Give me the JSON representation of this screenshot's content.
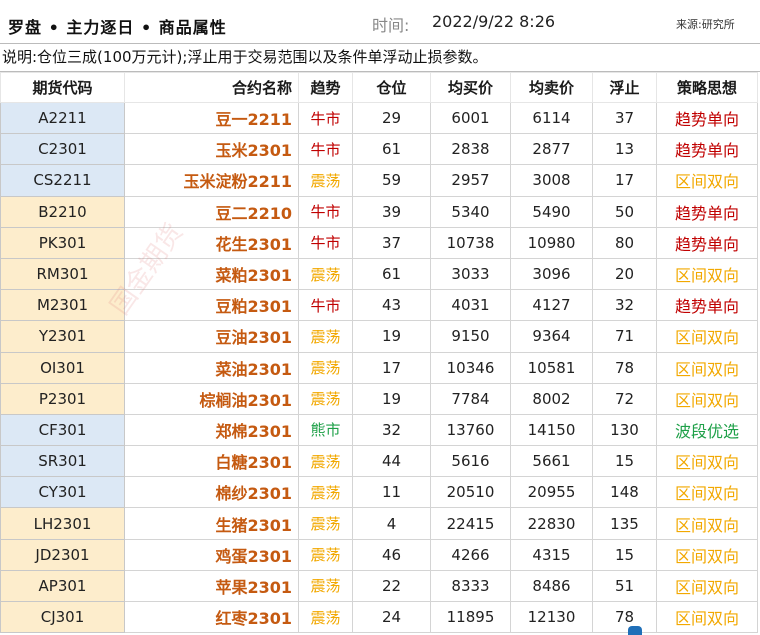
{
  "header": {
    "title": "罗盘 • 主力逐日 • 商品属性",
    "time_label": "时间:",
    "time_value": "2022/9/22 8:26",
    "source": "来源:研究所"
  },
  "note": "说明:仓位三成(100万元计);浮止用于交易范围以及条件单浮动止损参数。",
  "columns": [
    "期货代码",
    "合约名称",
    "趋势",
    "仓位",
    "均买价",
    "均卖价",
    "浮止",
    "策略思想"
  ],
  "rows": [
    {
      "code": "A2211",
      "name": "豆一2211",
      "trend": "牛市",
      "pos": "29",
      "buy": "6001",
      "sell": "6114",
      "stop": "37",
      "strategy": "趋势单向",
      "group": "blue",
      "trend_color": "red",
      "strat_color": "red"
    },
    {
      "code": "C2301",
      "name": "玉米2301",
      "trend": "牛市",
      "pos": "61",
      "buy": "2838",
      "sell": "2877",
      "stop": "13",
      "strategy": "趋势单向",
      "group": "blue",
      "trend_color": "red",
      "strat_color": "red"
    },
    {
      "code": "CS2211",
      "name": "玉米淀粉2211",
      "trend": "震荡",
      "pos": "59",
      "buy": "2957",
      "sell": "3008",
      "stop": "17",
      "strategy": "区间双向",
      "group": "blue",
      "trend_color": "yellow",
      "strat_color": "yellow"
    },
    {
      "code": "B2210",
      "name": "豆二2210",
      "trend": "牛市",
      "pos": "39",
      "buy": "5340",
      "sell": "5490",
      "stop": "50",
      "strategy": "趋势单向",
      "group": "yellow",
      "trend_color": "red",
      "strat_color": "red"
    },
    {
      "code": "PK301",
      "name": "花生2301",
      "trend": "牛市",
      "pos": "37",
      "buy": "10738",
      "sell": "10980",
      "stop": "80",
      "strategy": "趋势单向",
      "group": "yellow",
      "trend_color": "red",
      "strat_color": "red"
    },
    {
      "code": "RM301",
      "name": "菜粕2301",
      "trend": "震荡",
      "pos": "61",
      "buy": "3033",
      "sell": "3096",
      "stop": "20",
      "strategy": "区间双向",
      "group": "yellow",
      "trend_color": "yellow",
      "strat_color": "yellow"
    },
    {
      "code": "M2301",
      "name": "豆粕2301",
      "trend": "牛市",
      "pos": "43",
      "buy": "4031",
      "sell": "4127",
      "stop": "32",
      "strategy": "趋势单向",
      "group": "yellow",
      "trend_color": "red",
      "strat_color": "red"
    },
    {
      "code": "Y2301",
      "name": "豆油2301",
      "trend": "震荡",
      "pos": "19",
      "buy": "9150",
      "sell": "9364",
      "stop": "71",
      "strategy": "区间双向",
      "group": "yellow",
      "trend_color": "yellow",
      "strat_color": "yellow"
    },
    {
      "code": "OI301",
      "name": "菜油2301",
      "trend": "震荡",
      "pos": "17",
      "buy": "10346",
      "sell": "10581",
      "stop": "78",
      "strategy": "区间双向",
      "group": "yellow",
      "trend_color": "yellow",
      "strat_color": "yellow"
    },
    {
      "code": "P2301",
      "name": "棕榈油2301",
      "trend": "震荡",
      "pos": "19",
      "buy": "7784",
      "sell": "8002",
      "stop": "72",
      "strategy": "区间双向",
      "group": "yellow",
      "trend_color": "yellow",
      "strat_color": "yellow"
    },
    {
      "code": "CF301",
      "name": "郑棉2301",
      "trend": "熊市",
      "pos": "32",
      "buy": "13760",
      "sell": "14150",
      "stop": "130",
      "strategy": "波段优选",
      "group": "blue",
      "trend_color": "green",
      "strat_color": "green"
    },
    {
      "code": "SR301",
      "name": "白糖2301",
      "trend": "震荡",
      "pos": "44",
      "buy": "5616",
      "sell": "5661",
      "stop": "15",
      "strategy": "区间双向",
      "group": "blue",
      "trend_color": "yellow",
      "strat_color": "yellow"
    },
    {
      "code": "CY301",
      "name": "棉纱2301",
      "trend": "震荡",
      "pos": "11",
      "buy": "20510",
      "sell": "20955",
      "stop": "148",
      "strategy": "区间双向",
      "group": "blue",
      "trend_color": "yellow",
      "strat_color": "yellow"
    },
    {
      "code": "LH2301",
      "name": "生猪2301",
      "trend": "震荡",
      "pos": "4",
      "buy": "22415",
      "sell": "22830",
      "stop": "135",
      "strategy": "区间双向",
      "group": "yellow",
      "trend_color": "yellow",
      "strat_color": "yellow"
    },
    {
      "code": "JD2301",
      "name": "鸡蛋2301",
      "trend": "震荡",
      "pos": "46",
      "buy": "4266",
      "sell": "4315",
      "stop": "15",
      "strategy": "区间双向",
      "group": "yellow",
      "trend_color": "yellow",
      "strat_color": "yellow"
    },
    {
      "code": "AP301",
      "name": "苹果2301",
      "trend": "震荡",
      "pos": "22",
      "buy": "8333",
      "sell": "8486",
      "stop": "51",
      "strategy": "区间双向",
      "group": "yellow",
      "trend_color": "yellow",
      "strat_color": "yellow"
    },
    {
      "code": "CJ301",
      "name": "红枣2301",
      "trend": "震荡",
      "pos": "24",
      "buy": "11895",
      "sell": "12130",
      "stop": "78",
      "strategy": "区间双向",
      "group": "yellow",
      "trend_color": "yellow",
      "strat_color": "yellow"
    }
  ],
  "watermark": "国金期货",
  "colors": {
    "red": "#c00000",
    "yellow": "#f2a800",
    "green": "#1ea048",
    "name": "#c55a11",
    "blue_fill": "#dce8f5",
    "yellow_fill": "#fdedcc"
  }
}
